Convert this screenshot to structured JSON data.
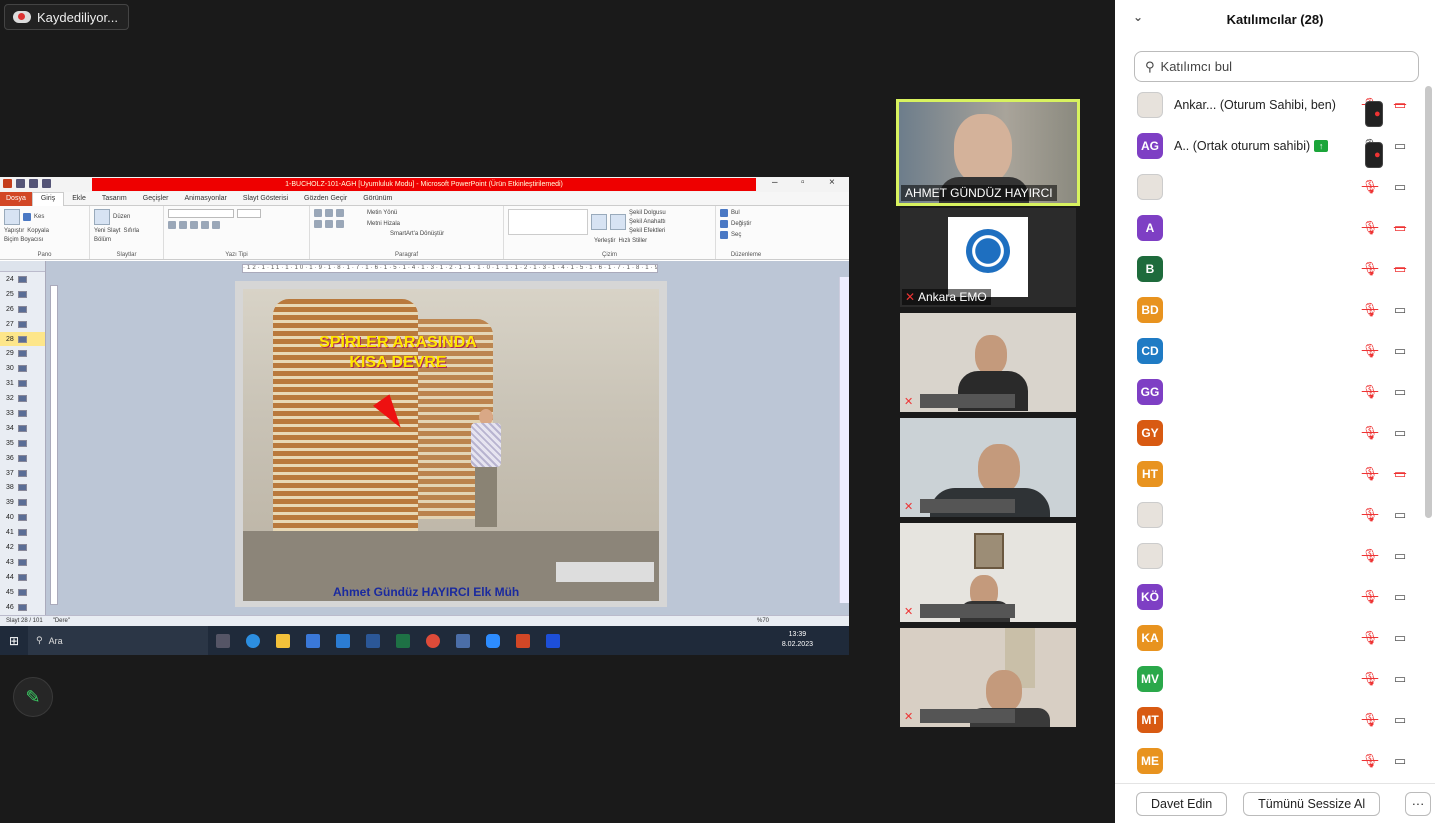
{
  "recording": {
    "label": "Kaydediliyor..."
  },
  "ppt": {
    "title_bar": "1-BUCHOLZ-101-AGH [Uyumluluk Modu] - Microsoft PowerPoint (Ürün Etkinleştirilemedi)",
    "tabs": [
      "Dosya",
      "Giriş",
      "Ekle",
      "Tasarım",
      "Geçişler",
      "Animasyonlar",
      "Slayt Gösterisi",
      "Gözden Geçir",
      "Görünüm"
    ],
    "active_tab": "Giriş",
    "groups": {
      "pano": {
        "label": "Pano",
        "items": [
          "Kes",
          "Kopyala",
          "Biçim Boyacısı"
        ],
        "paste": "Yapıştır"
      },
      "slaytlar": {
        "label": "Slaytlar",
        "new_slide": "Yeni Slayt",
        "items": [
          "Düzen",
          "Sıfırla",
          "Bölüm"
        ]
      },
      "yazi_tipi": {
        "label": "Yazı Tipi"
      },
      "paragraf": {
        "label": "Paragraf",
        "items": [
          "Metin Yönü",
          "Metni Hizala",
          "SmartArt'a Dönüştür"
        ]
      },
      "cizim": {
        "label": "Çizim",
        "items": [
          "Şekil Dolgusu",
          "Şekil Anahattı",
          "Şekil Efektleri"
        ],
        "arrange": "Yerleştir",
        "quick": "Hızlı Stiller"
      },
      "duzenleme": {
        "label": "Düzenleme",
        "items": [
          "Bul",
          "Değiştir",
          "Seç"
        ]
      }
    },
    "ruler_text": "·12·1·11·1·10·1·9·1·8·1·7·1·6·1·5·1·4·1·3·1·2·1·1·1·0·1·1·1·2·1·3·1·4·1·5·1·6·1·7·1·8·1·9·1·10·1·11·1·12·",
    "slide_numbers": [
      "24",
      "25",
      "26",
      "27",
      "28",
      "29",
      "30",
      "31",
      "32",
      "33",
      "34",
      "35",
      "36",
      "37",
      "38",
      "39",
      "40",
      "41",
      "42",
      "43",
      "44",
      "45",
      "46"
    ],
    "selected_slide": "28",
    "slide_title_line1": "SPİRLER ARASINDA",
    "slide_title_line2": "KISA DEVRE",
    "slide_footer": "Ahmet Gündüz HAYIRCI Elk Müh",
    "status_slide": "Slayt 28 / 101",
    "status_theme": "\"Dere\"",
    "zoom": "%70"
  },
  "taskbar": {
    "search": "Ara",
    "time": "13:39",
    "date": "8.02.2023"
  },
  "tiles": [
    {
      "name": "AHMET GÜNDÜZ HAYIRCI"
    },
    {
      "name": "Ankara EMO"
    }
  ],
  "panel": {
    "title": "Katılımcılar (28)",
    "search_placeholder": "Katılımcı bul",
    "participants": [
      {
        "initials": "",
        "name": "Ankar... (Oturum Sahibi, ben)",
        "color": "",
        "cam_off": true,
        "rec": true,
        "muted": true
      },
      {
        "initials": "AG",
        "name": "A.. (Ortak oturum sahibi)",
        "color": "#7e3fc4",
        "cam_off": false,
        "rec": true,
        "muted": false,
        "share": true
      },
      {
        "initials": "",
        "name": "",
        "color": "",
        "cam_off": false,
        "muted": true
      },
      {
        "initials": "A",
        "name": "",
        "color": "#7e3fc4",
        "cam_off": true,
        "muted": true
      },
      {
        "initials": "B",
        "name": "",
        "color": "#1e6b3c",
        "cam_off": true,
        "muted": true
      },
      {
        "initials": "BD",
        "name": "",
        "color": "#e8931f",
        "cam_off": false,
        "muted": true
      },
      {
        "initials": "CD",
        "name": "",
        "color": "#1f7bc4",
        "cam_off": false,
        "muted": true
      },
      {
        "initials": "GG",
        "name": "",
        "color": "#7e3fc4",
        "cam_off": false,
        "muted": true
      },
      {
        "initials": "GY",
        "name": "",
        "color": "#d85a12",
        "cam_off": false,
        "muted": true
      },
      {
        "initials": "HT",
        "name": "",
        "color": "#e8931f",
        "cam_off": true,
        "muted": true
      },
      {
        "initials": "",
        "name": "",
        "color": "",
        "cam_off": false,
        "muted": true
      },
      {
        "initials": "",
        "name": "",
        "color": "",
        "cam_off": false,
        "muted": true
      },
      {
        "initials": "KÖ",
        "name": "",
        "color": "#7e3fc4",
        "cam_off": false,
        "muted": true
      },
      {
        "initials": "KA",
        "name": "",
        "color": "#e8931f",
        "cam_off": false,
        "muted": true
      },
      {
        "initials": "MV",
        "name": "",
        "color": "#2aa84a",
        "cam_off": false,
        "muted": true
      },
      {
        "initials": "MT",
        "name": "",
        "color": "#d85a12",
        "cam_off": false,
        "muted": true
      },
      {
        "initials": "ME",
        "name": "",
        "color": "#e8931f",
        "cam_off": false,
        "muted": true
      }
    ],
    "invite": "Davet Edin",
    "mute_all": "Tümünü Sessize Al",
    "more": "···"
  }
}
